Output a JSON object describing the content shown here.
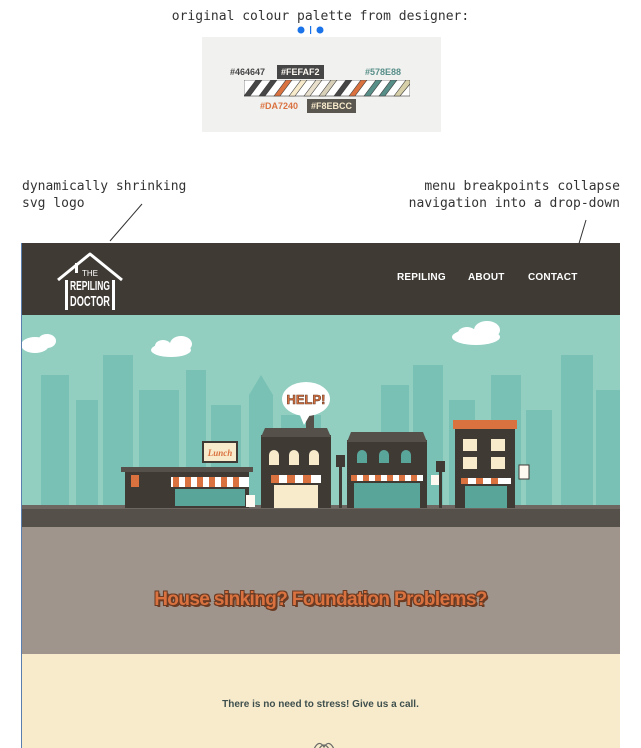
{
  "annotations": {
    "palette_title": "original colour palette from designer:",
    "logo_note_line1": "dynamically shrinking",
    "logo_note_line2": "svg logo",
    "menu_note_line1": "menu breakpoints collapse",
    "menu_note_line2": "navigation into a drop-down"
  },
  "palette": {
    "labels": [
      "#464647",
      "#FEFAF2",
      "#578E88",
      "#DA7240",
      "#F8EBCC"
    ],
    "colors": {
      "dark": "#464647",
      "offwhite": "#FEFAF2",
      "teal": "#578E88",
      "orange": "#DA7240",
      "cream": "#F8EBCC"
    }
  },
  "site": {
    "logo": {
      "line1": "THE",
      "line2": "REPILING",
      "line3": "DOCTOR"
    },
    "nav": [
      "REPILING",
      "ABOUT",
      "CONTACT"
    ],
    "hero": {
      "sign_text": "Lunch",
      "bubble_text": "HELP!"
    },
    "tagline": "House sinking? Foundation Problems?",
    "cta": "There is no need to stress! Give us a call.",
    "colors": {
      "header": "#3f3a34",
      "sky": "#92cfc1",
      "skyline": "#74bdb0",
      "road": "#56504a",
      "grey_band": "#a0958c",
      "cream_band": "#F8EBCC",
      "accent": "#DA7240"
    }
  }
}
